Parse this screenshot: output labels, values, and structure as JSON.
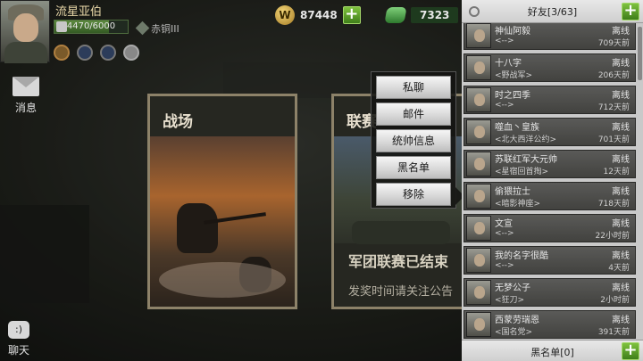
{
  "player": {
    "name": "流星亚伯",
    "hp_text": "4470/6000",
    "hp_fraction": 0.745,
    "rank": "赤铜III"
  },
  "currency": {
    "gold": "87448",
    "gems": "7323"
  },
  "left": {
    "messages_label": "消息",
    "chat_label": "聊天",
    "chat_icon": ":)"
  },
  "cards": {
    "battle_title": "战场",
    "league_title": "联赛",
    "league_ended": "军团联赛已结束",
    "league_notice": "发奖时间请关注公告"
  },
  "context_menu": [
    {
      "label": "私聊"
    },
    {
      "label": "邮件"
    },
    {
      "label": "统帅信息"
    },
    {
      "label": "黑名单"
    },
    {
      "label": "移除"
    }
  ],
  "friends": {
    "header": "好友[3/63]",
    "footer": "黑名单[0]",
    "list": [
      {
        "name": "神仙阿毅",
        "group": "<-->",
        "status": "离线",
        "time": "709天前"
      },
      {
        "name": "十八字",
        "group": "<野战军>",
        "status": "离线",
        "time": "206天前"
      },
      {
        "name": "时之四季",
        "group": "<-->",
        "status": "离线",
        "time": "712天前"
      },
      {
        "name": "噬血丶皇族",
        "group": "<北大西洋公约>",
        "status": "离线",
        "time": "701天前"
      },
      {
        "name": "苏联红军大元帅",
        "group": "<星宿回首掏>",
        "status": "离线",
        "time": "12天前"
      },
      {
        "name": "偷猥拉士",
        "group": "<暗影神座>",
        "status": "离线",
        "time": "718天前"
      },
      {
        "name": "文宣",
        "group": "<-->",
        "status": "离线",
        "time": "22小时前"
      },
      {
        "name": "我的名字很酷",
        "group": "<-->",
        "status": "离线",
        "time": "4天前"
      },
      {
        "name": "无梦公子",
        "group": "<狂刀>",
        "status": "离线",
        "time": "2小时前"
      },
      {
        "name": "西蒙劳瑞恩",
        "group": "<国名党>",
        "status": "离线",
        "time": "391天前"
      }
    ]
  },
  "colors": {
    "accent_green": "#7ec23e",
    "panel_bg": "#c9c9c9",
    "card_border": "#8d8269"
  }
}
